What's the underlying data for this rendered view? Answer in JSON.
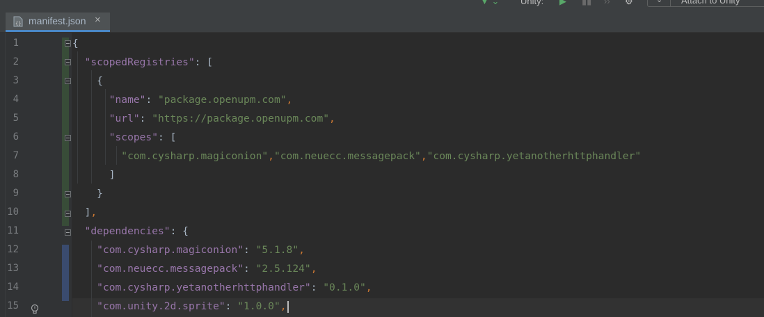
{
  "toolbar": {
    "config_label": "Unity:",
    "attach_label": "Attach to Unity",
    "icons": [
      "vcs-arrow-icon",
      "run-icon",
      "debug-icon",
      "step-icon",
      "profiler-icon",
      "chevron-down-icon"
    ]
  },
  "tab": {
    "label": "manifest.json",
    "close": "×",
    "icon": "json-file-icon"
  },
  "editor": {
    "line_numbers": [
      "1",
      "2",
      "3",
      "4",
      "5",
      "6",
      "7",
      "8",
      "9",
      "10",
      "11",
      "12",
      "13",
      "14",
      "15"
    ],
    "lines": [
      {
        "indent": "",
        "tokens": [
          {
            "t": "{",
            "c": "b"
          }
        ]
      },
      {
        "indent": "  ",
        "tokens": [
          {
            "t": "\"scopedRegistries\"",
            "c": "k"
          },
          {
            "t": ": [",
            "c": "b"
          }
        ]
      },
      {
        "indent": "    ",
        "tokens": [
          {
            "t": "{",
            "c": "b"
          }
        ]
      },
      {
        "indent": "      ",
        "tokens": [
          {
            "t": "\"name\"",
            "c": "k"
          },
          {
            "t": ": ",
            "c": "b"
          },
          {
            "t": "\"package.openupm.com\"",
            "c": "s"
          },
          {
            "t": ",",
            "c": "p"
          }
        ]
      },
      {
        "indent": "      ",
        "tokens": [
          {
            "t": "\"url\"",
            "c": "k"
          },
          {
            "t": ": ",
            "c": "b"
          },
          {
            "t": "\"https://package.openupm.com\"",
            "c": "s"
          },
          {
            "t": ",",
            "c": "p"
          }
        ]
      },
      {
        "indent": "      ",
        "tokens": [
          {
            "t": "\"scopes\"",
            "c": "k"
          },
          {
            "t": ": [",
            "c": "b"
          }
        ]
      },
      {
        "indent": "        ",
        "tokens": [
          {
            "t": "\"com.cysharp.magiconion\"",
            "c": "s"
          },
          {
            "t": ",",
            "c": "p"
          },
          {
            "t": "\"com.neuecc.messagepack\"",
            "c": "s"
          },
          {
            "t": ",",
            "c": "p"
          },
          {
            "t": "\"com.cysharp.yetanotherhttphandler\"",
            "c": "s"
          }
        ]
      },
      {
        "indent": "      ",
        "tokens": [
          {
            "t": "]",
            "c": "b"
          }
        ]
      },
      {
        "indent": "    ",
        "tokens": [
          {
            "t": "}",
            "c": "b"
          }
        ]
      },
      {
        "indent": "  ",
        "tokens": [
          {
            "t": "]",
            "c": "b"
          },
          {
            "t": ",",
            "c": "p"
          }
        ]
      },
      {
        "indent": "  ",
        "tokens": [
          {
            "t": "\"dependencies\"",
            "c": "k"
          },
          {
            "t": ": {",
            "c": "b"
          }
        ]
      },
      {
        "indent": "    ",
        "tokens": [
          {
            "t": "\"com.cysharp.magiconion\"",
            "c": "k"
          },
          {
            "t": ": ",
            "c": "b"
          },
          {
            "t": "\"5.1.8\"",
            "c": "s"
          },
          {
            "t": ",",
            "c": "p"
          }
        ]
      },
      {
        "indent": "    ",
        "tokens": [
          {
            "t": "\"com.neuecc.messagepack\"",
            "c": "k"
          },
          {
            "t": ": ",
            "c": "b"
          },
          {
            "t": "\"2.5.124\"",
            "c": "s"
          },
          {
            "t": ",",
            "c": "p"
          }
        ]
      },
      {
        "indent": "    ",
        "tokens": [
          {
            "t": "\"com.cysharp.yetanotherhttphandler\"",
            "c": "k"
          },
          {
            "t": ": ",
            "c": "b"
          },
          {
            "t": "\"0.1.0\"",
            "c": "s"
          },
          {
            "t": ",",
            "c": "p"
          }
        ]
      },
      {
        "indent": "    ",
        "tokens": [
          {
            "t": "\"com.unity.2d.sprite\"",
            "c": "k"
          },
          {
            "t": ": ",
            "c": "b"
          },
          {
            "t": "\"1.0.0\"",
            "c": "s"
          },
          {
            "t": ",",
            "c": "p"
          }
        ]
      }
    ]
  },
  "colors": {
    "background": "#2b2b2b",
    "gutter": "#313335",
    "key": "#9876aa",
    "string": "#6a8759",
    "punctuation": "#cc7832",
    "text": "#a9b7c6",
    "line_number": "#7a7d80",
    "accent": "#4a88c7"
  }
}
